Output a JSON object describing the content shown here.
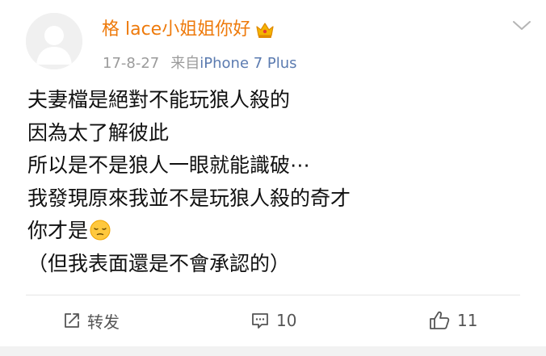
{
  "post": {
    "author": {
      "name": "格 lace小姐姐你好",
      "badge_icon": "crown-icon",
      "name_color": "#ee7a0b"
    },
    "meta": {
      "time": "17-8-27",
      "source_prefix": "来自",
      "device": "iPhone 7 Plus"
    },
    "menu_icon": "chevron-down-icon",
    "content": {
      "line1": "夫妻檔是絕對不能玩狼人殺的",
      "line2": "因為太了解彼此",
      "line3": "所以是不是狼人一眼就能識破⋯",
      "line4": "我發現原來我並不是玩狼人殺的奇才",
      "line5": "你才是",
      "line5_emoji": "pensive-face-emoji",
      "line6": "（但我表面還是不會承認的）"
    },
    "actions": {
      "repost": {
        "icon": "share-icon",
        "label": "转发"
      },
      "comment": {
        "icon": "comment-icon",
        "count": "10"
      },
      "like": {
        "icon": "thumbs-up-icon",
        "count": "11"
      }
    }
  }
}
